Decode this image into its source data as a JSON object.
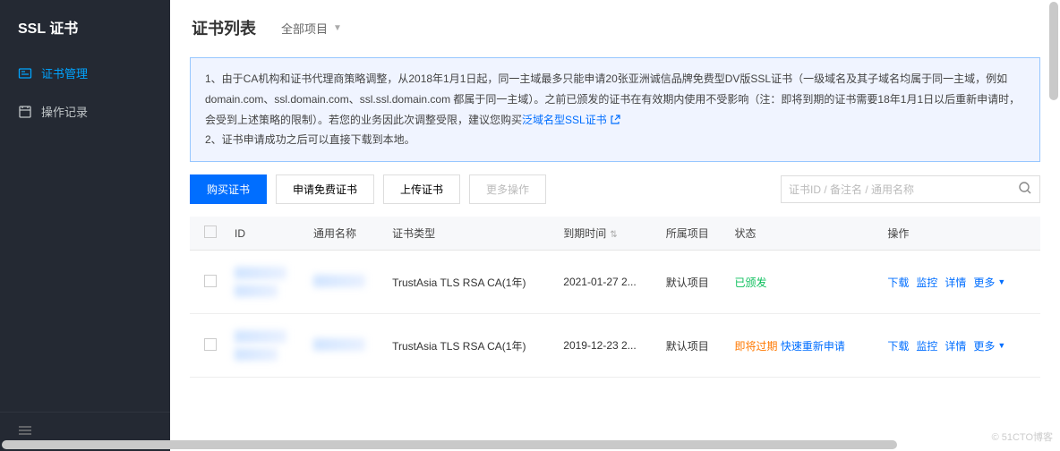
{
  "sidebar": {
    "title": "SSL 证书",
    "items": [
      {
        "label": "证书管理",
        "active": true
      },
      {
        "label": "操作记录",
        "active": false
      }
    ]
  },
  "header": {
    "title": "证书列表",
    "project_label": "全部项目"
  },
  "notice": {
    "line1_a": "1、由于CA机构和证书代理商策略调整，从2018年1月1日起，同一主域最多只能申请20张亚洲诚信品牌免费型DV版SSL证书（一级域名及其子域名均属于同一主域，例如domain.com、ssl.domain.com、ssl.ssl.domain.com 都属于同一主域）。之前已颁发的证书在有效期内使用不受影响（注：即将到期的证书需要18年1月1日以后重新申请时，会受到上述策略的限制）。若您的业务因此次调整受限，建议您购买",
    "link_text": "泛域名型SSL证书",
    "line2": "2、证书申请成功之后可以直接下载到本地。"
  },
  "toolbar": {
    "buy": "购买证书",
    "apply_free": "申请免费证书",
    "upload": "上传证书",
    "more": "更多操作"
  },
  "search": {
    "placeholder": "证书ID / 备注名 / 通用名称"
  },
  "table": {
    "headers": {
      "id": "ID",
      "common_name": "通用名称",
      "cert_type": "证书类型",
      "expire": "到期时间",
      "project": "所属项目",
      "status": "状态",
      "action": "操作"
    },
    "rows": [
      {
        "cert_type": "TrustAsia TLS RSA CA(1年)",
        "expire": "2021-01-27 2...",
        "project": "默认项目",
        "status": "已颁发",
        "status_class": "status-green",
        "extra_link": "",
        "actions": [
          "下载",
          "监控",
          "详情",
          "更多"
        ]
      },
      {
        "cert_type": "TrustAsia TLS RSA CA(1年)",
        "expire": "2019-12-23 2...",
        "project": "默认项目",
        "status": "即将过期",
        "status_class": "status-orange",
        "extra_link": "快速重新申请",
        "actions": [
          "下载",
          "监控",
          "详情",
          "更多"
        ]
      }
    ]
  },
  "watermark": "© 51CTO博客"
}
